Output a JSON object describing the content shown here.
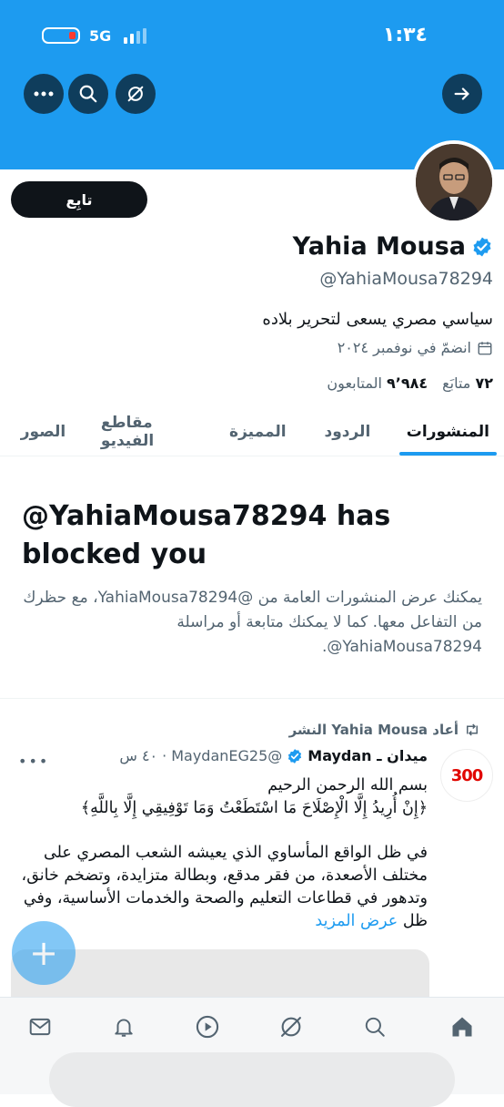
{
  "status_bar": {
    "time": "١:٣٤",
    "network": "5G"
  },
  "profile": {
    "follow_label": "تابِع",
    "name": "Yahia Mousa",
    "handle": "@YahiaMousa78294",
    "bio": "سياسي مصري يسعى لتحرير بلاده",
    "joined": "انضمّ في نوفمبر ٢٠٢٤",
    "following_count": "٧٢",
    "following_label": "متابَع",
    "followers_count": "٩٬٩٨٤",
    "followers_label": "المتابعون"
  },
  "tabs": [
    "المنشورات",
    "الردود",
    "المميزة",
    "مقاطع الفيديو",
    "الصور"
  ],
  "blocked": {
    "title": "@YahiaMousa78294 has blocked you",
    "description": "يمكنك عرض المنشورات العامة من @YahiaMousa78294، مع حظرك من التفاعل معها. كما لا يمكنك متابعة أو مراسلة YahiaMousa78294@."
  },
  "post": {
    "retweet_by": "أعاد Yahia Mousa النشر",
    "author": "ميدان ـ Maydan",
    "author_handle": "@MaydanEG25",
    "time": "٤٠ س",
    "avatar_text": "300",
    "line1": "بسم الله الرحمن الرحيم",
    "line2": "﴿إِنْ أُرِيدُ إِلَّا الْإِصْلَاحَ مَا اسْتَطَعْتُ وَمَا تَوْفِيقِي إِلَّا بِاللَّهِ﴾",
    "body": "في ظل الواقع المأساوي الذي يعيشه الشعب المصري على مختلف الأصعدة، من فقر مدقع، وبطالة متزايدة، وتضخم خانق، وتدهور في قطاعات التعليم والصحة والخدمات الأساسية، وفي ظل",
    "show_more": "عرض المزيد"
  },
  "fab_label": "+",
  "colors": {
    "brand": "#1d9bf0",
    "text": "#0f1419",
    "muted": "#536471"
  }
}
